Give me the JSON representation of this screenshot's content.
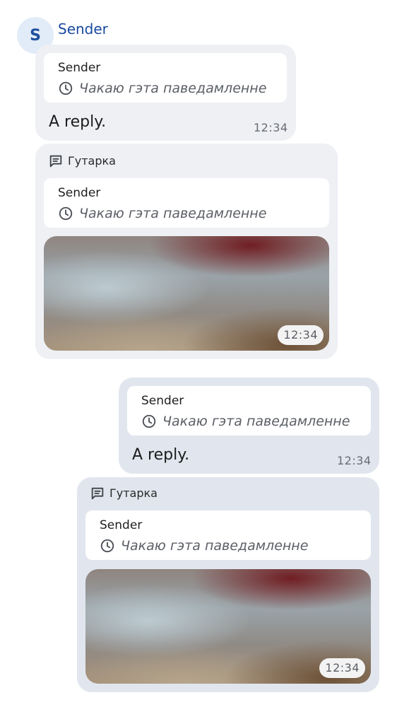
{
  "sender": {
    "initial": "S",
    "name": "Sender"
  },
  "messages": [
    {
      "quote": {
        "name": "Sender",
        "status": "Чакаю гэта паведамленне",
        "icon": "clock-icon"
      },
      "text": "A reply.",
      "time": "12:34"
    },
    {
      "thread_label": "Гутарка",
      "thread_icon": "thread-icon",
      "quote": {
        "name": "Sender",
        "status": "Чакаю гэта паведамленне",
        "icon": "clock-icon"
      },
      "image_time": "12:34"
    },
    {
      "quote": {
        "name": "Sender",
        "status": "Чакаю гэта паведамленне",
        "icon": "clock-icon"
      },
      "text": "A reply.",
      "time": "12:34"
    },
    {
      "thread_label": "Гутарка",
      "thread_icon": "thread-icon",
      "quote": {
        "name": "Sender",
        "status": "Чакаю гэта паведамленне",
        "icon": "clock-icon"
      },
      "image_time": "12:34"
    }
  ],
  "colors": {
    "incoming_bubble": "#eef0f4",
    "outgoing_bubble": "#e1e6ee",
    "sender_name": "#1b4aa0",
    "avatar_bg": "#e2ecf8"
  }
}
